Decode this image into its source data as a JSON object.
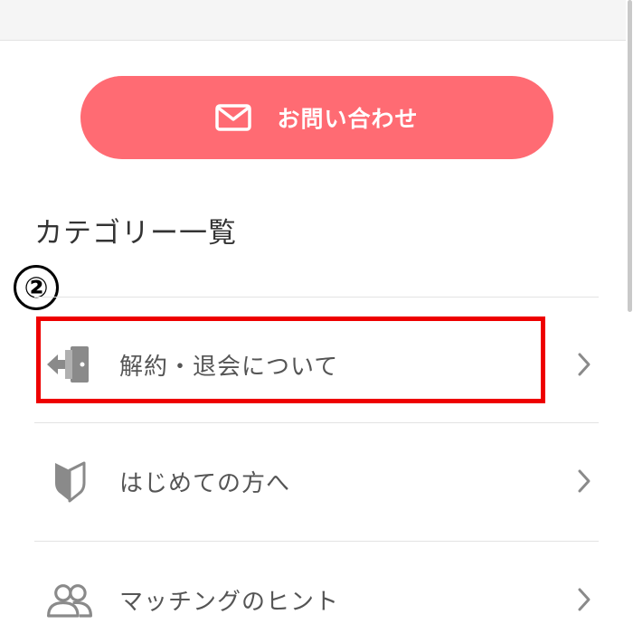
{
  "contact": {
    "label": "お問い合わせ",
    "icon": "mail-icon"
  },
  "categories": {
    "title": "カテゴリー一覧",
    "items": [
      {
        "label": "解約・退会について",
        "icon": "exit-door-icon"
      },
      {
        "label": "はじめての方へ",
        "icon": "beginner-mark-icon"
      },
      {
        "label": "マッチングのヒント",
        "icon": "users-icon"
      }
    ]
  },
  "annotation": {
    "step_marker": "②",
    "highlight_color": "#ee0000"
  },
  "colors": {
    "accent": "#ff6b73",
    "icon": "#8a8a8a",
    "text": "#555555"
  }
}
